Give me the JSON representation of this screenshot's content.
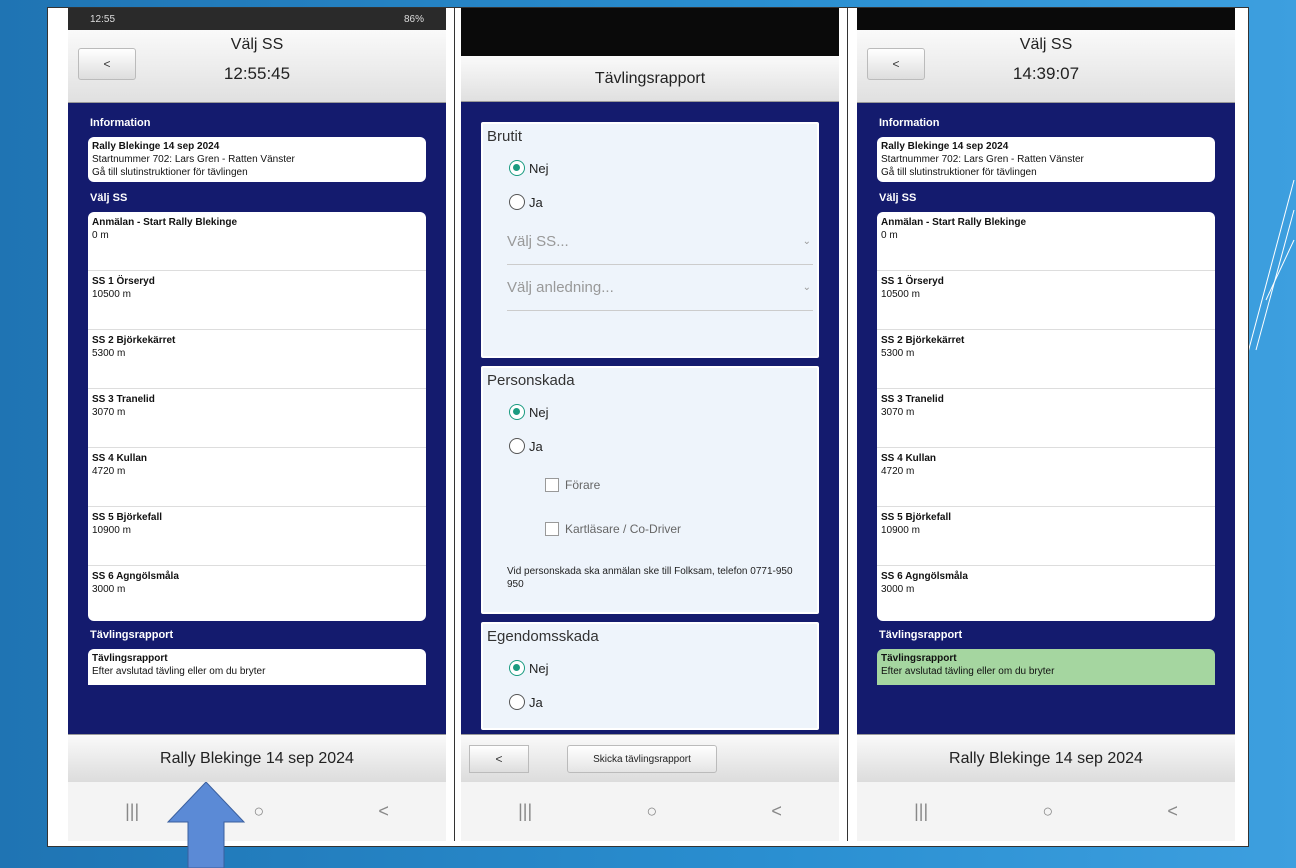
{
  "screens": {
    "left": {
      "status_time": "12:55",
      "status_right": "86%",
      "title": "Välj SS",
      "clock": "12:55:45",
      "back": "<",
      "info_label": "Information",
      "info_title": "Rally Blekinge 14 sep 2024",
      "info_line1": "Startnummer 702: Lars Gren - Ratten Vänster",
      "info_line2": "Gå till slutinstruktioner för tävlingen",
      "ss_label": "Välj SS",
      "report_label": "Tävlingsrapport",
      "report_title": "Tävlingsrapport",
      "report_sub": "Efter avslutad tävling eller om du bryter",
      "footer": "Rally Blekinge 14 sep 2024"
    },
    "middle": {
      "title": "Tävlingsrapport",
      "brutit": "Brutit",
      "nej": "Nej",
      "ja": "Ja",
      "select_ss": "Välj SS...",
      "select_reason": "Välj anledning...",
      "personskada": "Personskada",
      "forare": "Förare",
      "kartlasare": "Kartläsare / Co-Driver",
      "note": "Vid personskada ska anmälan ske till Folksam, telefon 0771-950 950",
      "egendomsskada": "Egendomsskada",
      "back": "<",
      "send": "Skicka tävlingsrapport"
    },
    "right": {
      "title": "Välj SS",
      "clock": "14:39:07",
      "back": "<",
      "footer": "Rally Blekinge 14 sep 2024"
    }
  },
  "stages": [
    {
      "name": "Anmälan - Start Rally Blekinge",
      "dist": "0 m"
    },
    {
      "name": "SS 1 Örseryd",
      "dist": "10500 m"
    },
    {
      "name": "SS 2 Björkekärret",
      "dist": "5300 m"
    },
    {
      "name": "SS 3 Tranelid",
      "dist": "3070 m"
    },
    {
      "name": "SS 4 Kullan",
      "dist": "4720 m"
    },
    {
      "name": "SS 5 Björkefall",
      "dist": "10900 m"
    },
    {
      "name": "SS 6 Agngölsmåla",
      "dist": "3000 m"
    }
  ],
  "nav": {
    "recent": "|||",
    "home": "○",
    "back": "<"
  },
  "colors": {
    "bg_blue": "#141b6e",
    "radio_on": "#1a9b80",
    "report_green": "#a5d6a0",
    "arrow": "#5b8ad6"
  }
}
